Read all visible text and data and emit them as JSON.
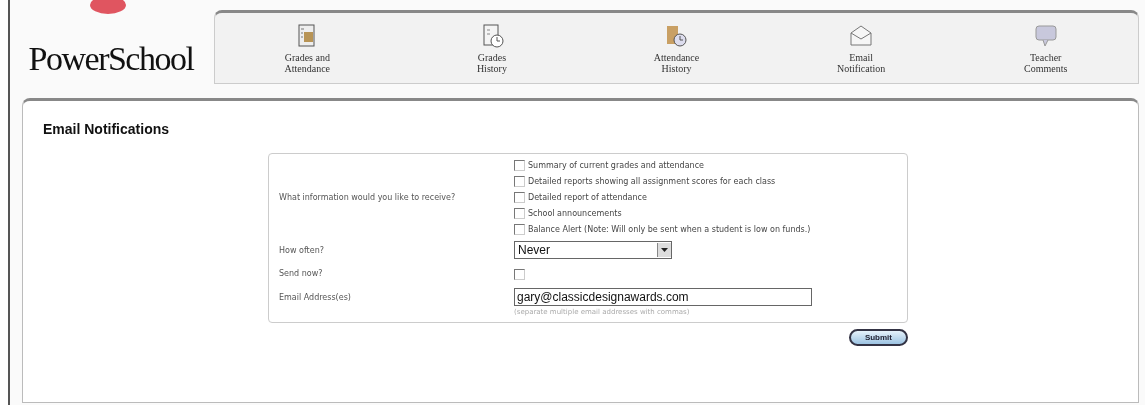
{
  "logo": {
    "text": "PowerSchool"
  },
  "nav": [
    {
      "label": "Grades and Attendance"
    },
    {
      "label": "Grades History"
    },
    {
      "label": "Attendance History"
    },
    {
      "label": "Email Notification"
    },
    {
      "label": "Teacher Comments"
    }
  ],
  "page_title": "Email Notifications",
  "form": {
    "info_label": "What information would you like to receive?",
    "options": [
      {
        "label": "Summary of current grades and attendance",
        "checked": false
      },
      {
        "label": "Detailed reports showing all assignment scores for each class",
        "checked": false
      },
      {
        "label": "Detailed report of attendance",
        "checked": false
      },
      {
        "label": "School announcements",
        "checked": false
      },
      {
        "label": "Balance Alert (Note: Will only be sent when a student is low on funds.)",
        "checked": false
      }
    ],
    "frequency_label": "How often?",
    "frequency_value": "Never",
    "send_now_label": "Send now?",
    "send_now": false,
    "email_label": "Email Address(es)",
    "email_value": "gary@classicdesignawards.com",
    "email_hint": "(separate multiple email addresses with commas)"
  },
  "submit": "Submit"
}
